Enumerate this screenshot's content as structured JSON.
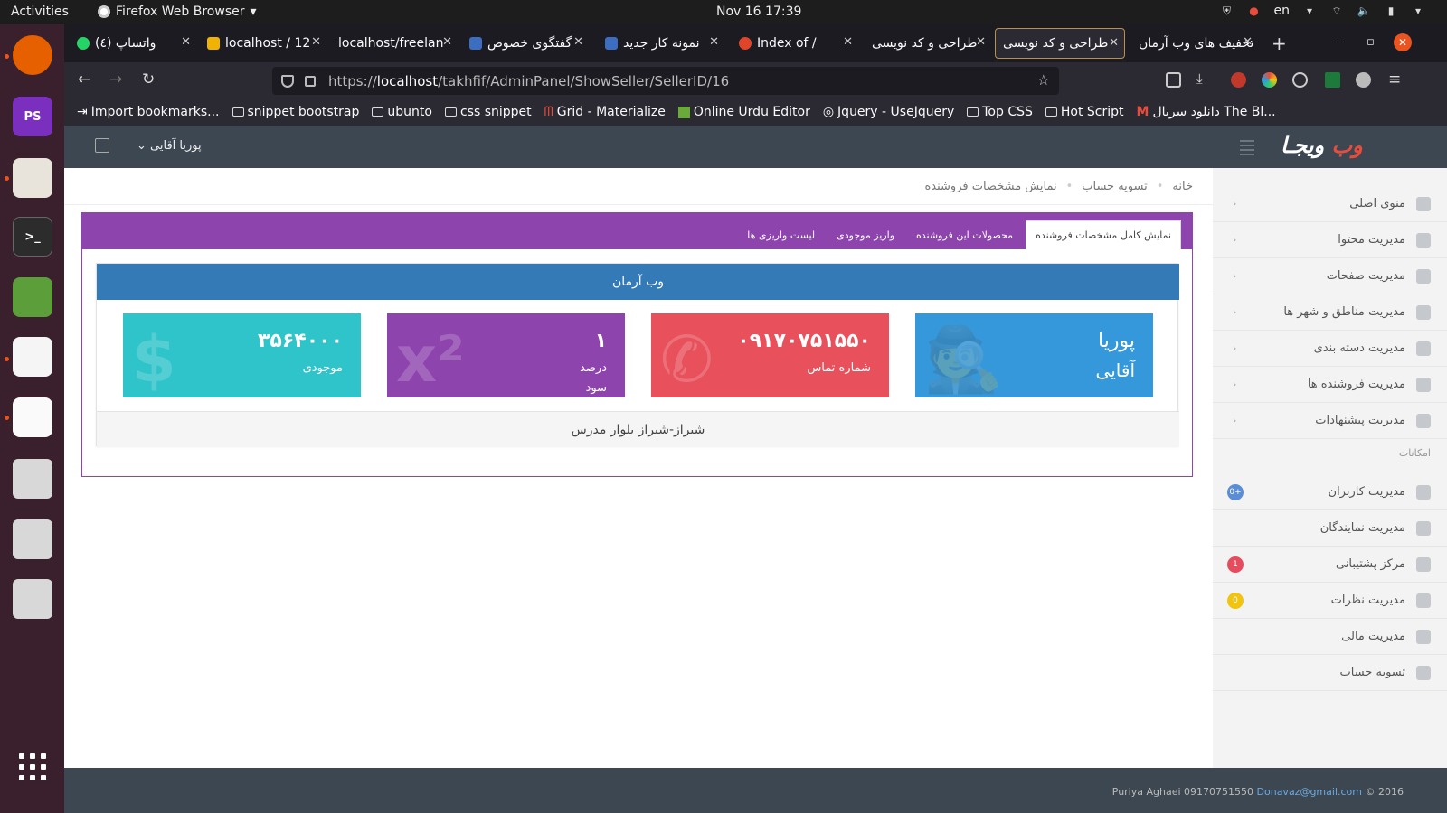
{
  "system": {
    "activities": "Activities",
    "app_name": "Firefox Web Browser",
    "clock": "Nov 16  17:39",
    "keyboard": "en"
  },
  "browser": {
    "tabs": [
      {
        "label": "واتساپ (٤)",
        "icon_color": "#25d366"
      },
      {
        "label": "localhost / 12",
        "icon_color": "#f0b400"
      },
      {
        "label": "localhost/freelan",
        "icon_color": "#555555"
      },
      {
        "label": "گفتگوی خصوص",
        "icon_color": "#3b6ec0"
      },
      {
        "label": "نمونه کار جدید",
        "icon_color": "#3b6ec0"
      },
      {
        "label": "Index of /",
        "icon_color": "#e0452c"
      },
      {
        "label": "طراحی و کد نویسی",
        "icon_color": "#444444"
      },
      {
        "label": "طراحی و کد نویسی",
        "icon_color": "#444444"
      },
      {
        "label": "تخفیف های وب آرمان",
        "icon_color": "#444444"
      }
    ],
    "url_prefix": "https://",
    "url_host": "localhost",
    "url_path": "/takhfif/AdminPanel/ShowSeller/SellerID/16",
    "bookmarks": [
      "Import bookmarks...",
      "snippet bootstrap",
      "ubunto",
      "css snippet",
      "Grid - Materialize",
      "Online Urdu Editor",
      "Jquery - UseJquery",
      "Top CSS",
      "Hot Script",
      "دانلود سریال The Bl..."
    ]
  },
  "header": {
    "user_name": "پوریا آقایی",
    "logo_main": "ویجـا",
    "logo_accent": "وب"
  },
  "sidebar": {
    "items": [
      {
        "label": "منوی اصلی",
        "chevron": "‹"
      },
      {
        "label": "مدیریت محتوا",
        "chevron": "‹"
      },
      {
        "label": "مدیریت صفحات",
        "chevron": "‹"
      },
      {
        "label": "مدیریت مناطق و شهر ها",
        "chevron": "‹"
      },
      {
        "label": "مدیریت دسته بندی",
        "chevron": "‹"
      },
      {
        "label": "مدیریت فروشنده ها",
        "chevron": "‹"
      },
      {
        "label": "مدیریت پیشنهادات",
        "chevron": "‹"
      }
    ],
    "section_heading": "امکانات",
    "items2": [
      {
        "label": "مدیریت کاربران",
        "badge": "+0",
        "badge_color": "#5b8dd6"
      },
      {
        "label": "مدیریت نمایندگان",
        "badge": "",
        "badge_color": ""
      },
      {
        "label": "مرکز پشتیبانی",
        "badge": "1",
        "badge_color": "#e74c5e"
      },
      {
        "label": "مدیریت نظرات",
        "badge": "0",
        "badge_color": "#f1c40f"
      },
      {
        "label": "مدیریت مالی",
        "badge": "",
        "badge_color": ""
      },
      {
        "label": "تسویه حساب",
        "badge": "",
        "badge_color": ""
      }
    ]
  },
  "breadcrumb": {
    "home": "خانه",
    "parent": "تسویه حساب",
    "current": "نمایش مشخصات فروشنده"
  },
  "panel": {
    "tabs": [
      "نمایش کامل مشخصات فروشنده",
      "محصولات این فروشنده",
      "واریز موجودی",
      "لیست واریزی ها"
    ],
    "store_name": "وب آرمان",
    "tiles": [
      {
        "big": "پوریا",
        "small": "آقایی",
        "color": "#3498db",
        "bg": "🕵"
      },
      {
        "big": "۰۹۱۷۰۷۵۱۵۵۰",
        "small": "شماره تماس",
        "color": "#e8505b",
        "bg": "✆"
      },
      {
        "big": "۱",
        "small": "درصد سود",
        "color": "#8e44ad",
        "bg": "x²"
      },
      {
        "big": "۳۵۶۴۰۰۰",
        "small": "موجودی",
        "color": "#2ec4c9",
        "bg": "$"
      }
    ],
    "address": "شیراز-شیراز بلوار مدرس"
  },
  "footer": {
    "owner": "Puriya Aghaei 09170751550",
    "email": "Donavaz@gmail.com",
    "copyright": "© 2016"
  }
}
